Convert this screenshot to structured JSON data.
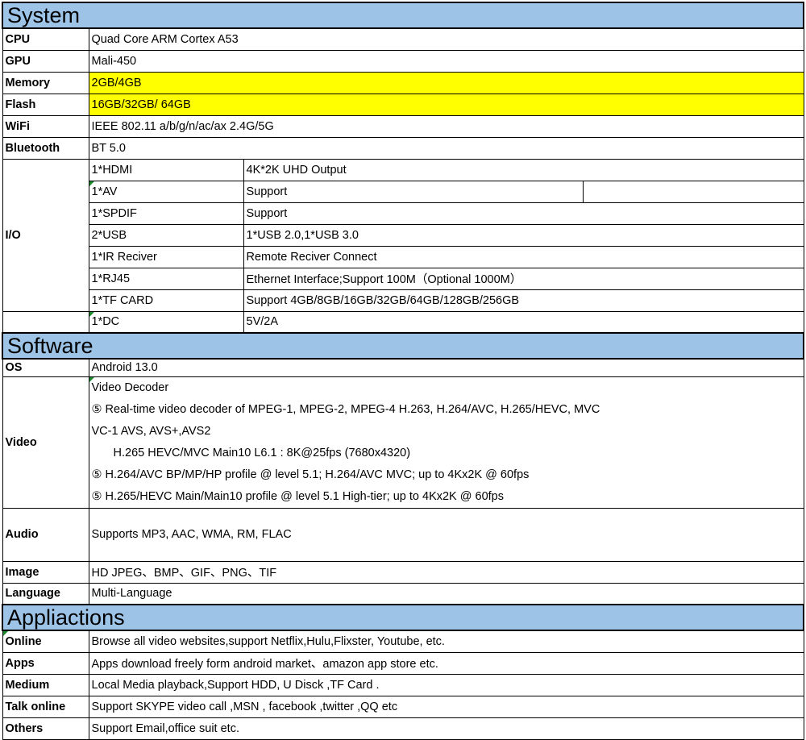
{
  "sections": {
    "system": "System",
    "software": "Software",
    "applications": "Appliactions"
  },
  "system": {
    "cpu": {
      "label": "CPU",
      "value": "Quad Core ARM Cortex A53"
    },
    "gpu": {
      "label": "GPU",
      "value": "Mali-450"
    },
    "memory": {
      "label": "Memory",
      "value": "2GB/4GB"
    },
    "flash": {
      "label": "Flash",
      "value": "16GB/32GB/ 64GB"
    },
    "wifi": {
      "label": "WiFi",
      "value": "IEEE 802.11 a/b/g/n/ac/ax   2.4G/5G"
    },
    "bluetooth": {
      "label": "Bluetooth",
      "value": "BT 5.0"
    }
  },
  "io": {
    "label": "I/O",
    "ports": [
      {
        "port": "1*HDMI",
        "desc": "4K*2K UHD Output"
      },
      {
        "port": "1*AV",
        "desc": "Support"
      },
      {
        "port": "1*SPDIF",
        "desc": "Support"
      },
      {
        "port": "2*USB",
        "desc": "1*USB 2.0,1*USB 3.0"
      },
      {
        "port": "1*IR Reciver",
        "desc": "Remote Reciver Connect"
      },
      {
        "port": "1*RJ45",
        "desc": "Ethernet Interface;Support 100M（Optional 1000M）"
      },
      {
        "port": "1*TF CARD",
        "desc": "Support 4GB/8GB/16GB/32GB/64GB/128GB/256GB"
      },
      {
        "port": "1*DC",
        "desc": "5V/2A"
      }
    ]
  },
  "software": {
    "os": {
      "label": "OS",
      "value": "Android 13.0"
    },
    "video": {
      "label": "Video",
      "title": "Video Decoder",
      "bullet": "⑤",
      "lines": [
        "Real-time video decoder of MPEG-1, MPEG-2, MPEG-4  H.263, H.264/AVC, H.265/HEVC, MVC",
        "VC-1 AVS, AVS+,AVS2",
        "H.265 HEVC/MVC Main10 L6.1 : 8K@25fps (7680x4320)",
        "H.264/AVC BP/MP/HP profile @ level 5.1; H.264/AVC MVC; up to 4Kx2K @ 60fps",
        "H.265/HEVC Main/Main10 profile @ level 5.1 High-tier; up to 4Kx2K @ 60fps"
      ]
    },
    "audio": {
      "label": "Audio",
      "value": "Supports MP3, AAC, WMA, RM, FLAC"
    },
    "image": {
      "label": "Image",
      "value": "HD JPEG、BMP、GIF、PNG、TIF"
    },
    "language": {
      "label": "Language",
      "value": "Multi-Language"
    }
  },
  "applications": {
    "online": {
      "label": "Online",
      "value": "Browse all video websites,support Netflix,Hulu,Flixster, Youtube, etc."
    },
    "apps": {
      "label": "Apps",
      "value": "Apps download freely form android market、amazon app store etc."
    },
    "medium": {
      "label": "Medium",
      "value": "Local Media playback,Support HDD, U Disck ,TF Card ."
    },
    "talk": {
      "label": "Talk online",
      "value": "Support  SKYPE video  call ,MSN , facebook ,twitter ,QQ  etc"
    },
    "others": {
      "label": "Others",
      "value": "Support Email,office suit etc."
    }
  },
  "colors": {
    "section_header_bg": "#9dc3e6",
    "highlight_bg": "#ffff00",
    "comment_marker": "#1a8a2a"
  }
}
